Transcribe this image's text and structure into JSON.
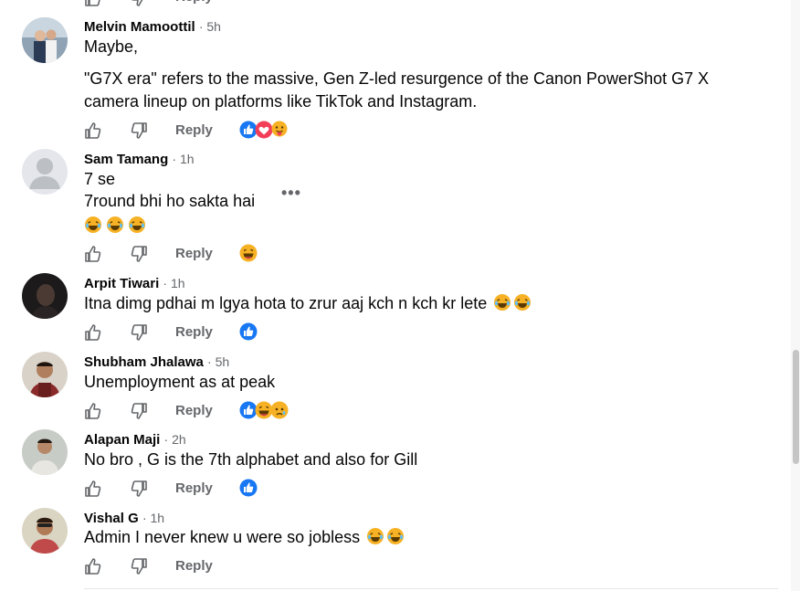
{
  "action_labels": {
    "reply": "Reply"
  },
  "comments": [
    {
      "author": "Melvin Mamoottil",
      "time": "· 5h",
      "lines": [
        "Maybe,",
        "\"G7X era\" refers to the massive, Gen Z-led resurgence of the Canon PowerShot G7 X",
        "camera lineup on platforms like TikTok and Instagram."
      ],
      "reactions": [
        "like-reaction",
        "love-reaction",
        "care-reaction"
      ]
    },
    {
      "author": "Sam Tamang",
      "time": "· 1h",
      "lines": [
        "7 se",
        "7round bhi ho sakta hai"
      ],
      "emoji": [
        "laughing-emoji",
        "laughing-emoji",
        "laughing-emoji"
      ],
      "reactions": [
        "haha-reaction"
      ]
    },
    {
      "author": "Arpit Tiwari",
      "time": "· 1h",
      "lines": [
        "Itna dimg pdhai m lgya hota to zrur aaj kch n kch kr lete"
      ],
      "reactions": [
        "like-reaction"
      ]
    },
    {
      "author": "Shubham Jhalawa",
      "time": "· 5h",
      "lines": [
        "Unemployment as at peak"
      ],
      "reactions": [
        "like-reaction",
        "haha-reaction",
        "sad-reaction"
      ]
    },
    {
      "author": "Alapan Maji",
      "time": "· 2h",
      "lines": [
        "No bro , G is the 7th alphabet and also for Gill"
      ],
      "reactions": [
        "like-reaction"
      ]
    },
    {
      "author": "Vishal G",
      "time": "· 1h",
      "lines": [
        "Admin I never knew u were so jobless"
      ],
      "reactions": []
    }
  ],
  "colors": {
    "like_blue": "#1877f2",
    "love_red": "#f33e58",
    "haha_yellow": "#f7b125",
    "meta_gray": "#65676b"
  }
}
